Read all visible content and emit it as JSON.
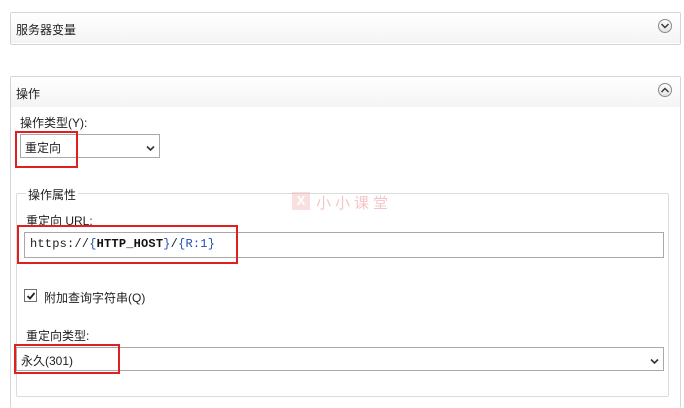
{
  "server_variables": {
    "title": "服务器变量"
  },
  "action": {
    "title": "操作",
    "type_label": "操作类型(Y):",
    "type_value": "重定向",
    "properties": {
      "legend": "操作属性",
      "url_label": "重定向 URL:",
      "url_value": {
        "prefix": "https://",
        "open1": "{",
        "var1": "HTTP_HOST",
        "close1": "}",
        "slash": "/",
        "open2": "{",
        "var2": "R:1",
        "close2": "}"
      },
      "append_query_label": "附加查询字符串(Q)",
      "append_query_checked": true,
      "redirect_type_label": "重定向类型:",
      "redirect_type_value": "永久(301)"
    }
  },
  "watermark": {
    "logo": "X",
    "text": "小小课堂"
  },
  "colors": {
    "highlight": "#e02020",
    "link_blue": "#1f4fb0"
  }
}
